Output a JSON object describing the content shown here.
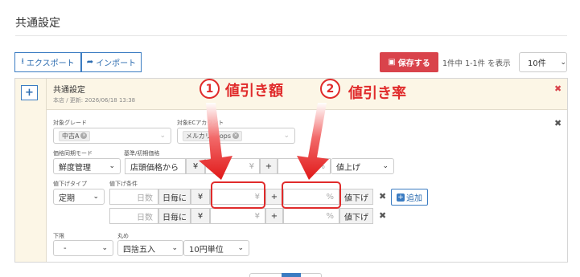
{
  "page": {
    "title": "共通設定"
  },
  "toolbar": {
    "export_label": "エクスポート",
    "import_label": "インポート",
    "save_label": "保存する",
    "count_text": "1件中 1-1件 を表示",
    "per_page": "10件"
  },
  "setting": {
    "name": "共通設定",
    "meta": "本店 / 更新: 2026/06/18 13:38"
  },
  "form": {
    "grade_label": "対象グレード",
    "grade_tag": "中古A",
    "ec_label": "対象ECアカウント",
    "ec_tag": "メルカリShops",
    "sync_mode_label": "価格同期モード",
    "sync_mode_value": "鮮度管理",
    "base_price_label": "基準/初期価格",
    "base_price_value": "店頭価格から",
    "yen": "¥",
    "plus": "+",
    "raise_value": "値上げ",
    "markdown_type_label": "値下げタイプ",
    "markdown_type_value": "定期",
    "markdown_cond_label": "値下げ条件",
    "days_placeholder": "日数",
    "per_day": "日毎に",
    "percent": "%",
    "lower": "値下げ",
    "add_label": "追加",
    "lower_limit_label": "下限",
    "lower_limit_value": "-",
    "rounding_label": "丸め",
    "rounding_value": "四捨五入",
    "unit_value": "10円単位"
  },
  "annotations": {
    "one_num": "1",
    "one_text": "値引き額",
    "two_num": "2",
    "two_text": "値引き率"
  },
  "colors": {
    "accent": "#3b7cc2",
    "danger": "#d9434b",
    "annotation": "#e02b2b",
    "panel_bg": "#fcf6e6"
  }
}
